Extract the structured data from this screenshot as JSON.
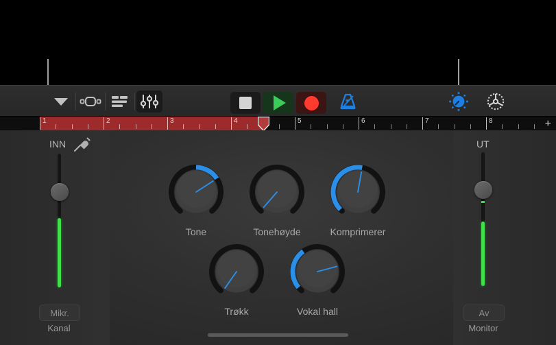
{
  "app": {
    "title": "GarageBand Recording View",
    "accent_blue": "#2b8fe8",
    "green": "#3fe04a",
    "record_red": "#ff3b30",
    "ruler_red": "#9e2b2b"
  },
  "callouts": [
    {
      "name": "input-callout",
      "target": "INN"
    },
    {
      "name": "tuner-callout",
      "target": "tuner-button"
    }
  ],
  "toolbar": {
    "left_buttons": [
      {
        "name": "navigation-chevron",
        "icon": "chevron-down-icon",
        "label": "Navigasjon",
        "active": false
      },
      {
        "name": "cycle-button",
        "icon": "cycle-icon",
        "label": "Sykel",
        "active": false
      },
      {
        "name": "tracks-button",
        "icon": "tracks-list-icon",
        "label": "Spor",
        "active": false
      },
      {
        "name": "mixer-button",
        "icon": "faders-icon",
        "label": "Mikser",
        "active": true
      }
    ],
    "transport": [
      {
        "name": "stop-button",
        "icon": "stop-icon",
        "label": "Stopp"
      },
      {
        "name": "play-button",
        "icon": "play-icon",
        "label": "Spill"
      },
      {
        "name": "record-button",
        "icon": "record-icon",
        "label": "Ta opp"
      }
    ],
    "metronome": {
      "name": "metronome-button",
      "icon": "metronome-icon",
      "label": "Metronom"
    },
    "right_buttons": [
      {
        "name": "tuner-button",
        "icon": "tuner-icon",
        "label": "Stemmeapparat",
        "active": true
      },
      {
        "name": "settings-button",
        "icon": "gear-icon",
        "label": "Innstillinger",
        "active": false
      }
    ]
  },
  "ruler": {
    "bars": [
      "1",
      "2",
      "3",
      "4",
      "5",
      "6",
      "7",
      "8"
    ],
    "cycle_start_bar": 1,
    "cycle_end_bar": 4.5,
    "playhead_bar": 4.5,
    "add_label": "+"
  },
  "input_strip": {
    "label": "INN",
    "icon": "audio-jack-icon",
    "fader_value": 0.63,
    "meter_level": 0.52,
    "peak_tick": 0.66,
    "button_label": "Mikr.",
    "caption": "Kanal"
  },
  "output_strip": {
    "label": "UT",
    "fader_value": 0.64,
    "meter_level": 0.48,
    "peak_tick": 0.62,
    "button_label": "Av",
    "caption": "Monitor"
  },
  "knobs": [
    {
      "name": "knob-tone",
      "label": "Tone",
      "angle_deg": 57,
      "arc_from_deg": 0,
      "arc_to_deg": 57,
      "has_arc": true
    },
    {
      "name": "knob-tonehoyde",
      "label": "Tonehøyde",
      "angle_deg": 221,
      "arc_from_deg": 0,
      "arc_to_deg": 0,
      "has_arc": false
    },
    {
      "name": "knob-komprimerer",
      "label": "Komprimerer",
      "angle_deg": 10,
      "arc_from_deg": -135,
      "arc_to_deg": 10,
      "has_arc": true
    },
    {
      "name": "knob-trokk",
      "label": "Trøkk",
      "angle_deg": 215,
      "arc_from_deg": 0,
      "arc_to_deg": 0,
      "has_arc": false
    },
    {
      "name": "knob-vokalhall",
      "label": "Vokal hall",
      "angle_deg": 75,
      "arc_from_deg": -130,
      "arc_to_deg": -35,
      "has_arc": true
    }
  ]
}
